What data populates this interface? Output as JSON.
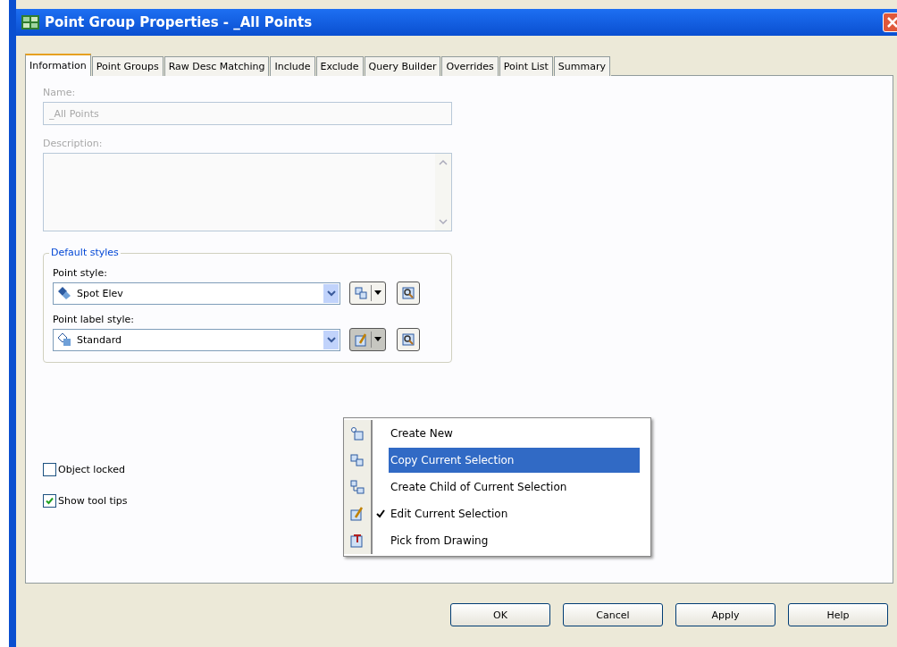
{
  "window": {
    "title": "Point Group Properties - _All Points"
  },
  "tabs": [
    {
      "label": "Information",
      "selected": true
    },
    {
      "label": "Point Groups",
      "selected": false
    },
    {
      "label": "Raw Desc Matching",
      "selected": false
    },
    {
      "label": "Include",
      "selected": false
    },
    {
      "label": "Exclude",
      "selected": false
    },
    {
      "label": "Query Builder",
      "selected": false
    },
    {
      "label": "Overrides",
      "selected": false
    },
    {
      "label": "Point List",
      "selected": false
    },
    {
      "label": "Summary",
      "selected": false
    }
  ],
  "name": {
    "label": "Name:",
    "value": "_All Points",
    "disabled": true
  },
  "description": {
    "label": "Description:",
    "disabled": true
  },
  "default_styles": {
    "title": "Default styles",
    "styles": [
      {
        "label": "Point style:",
        "value": "Spot Elev",
        "kind": "point"
      },
      {
        "label": "Point label style:",
        "value": "Standard",
        "kind": "label"
      }
    ]
  },
  "menu": {
    "items": [
      {
        "label": "Create New",
        "kind": "new",
        "selected": false,
        "checked": false
      },
      {
        "label": "Copy Current Selection",
        "kind": "copy",
        "selected": true,
        "checked": false
      },
      {
        "label": "Create Child of Current Selection",
        "kind": "child",
        "selected": false,
        "checked": false
      },
      {
        "label": "Edit Current Selection",
        "kind": "edit",
        "selected": false,
        "checked": true
      },
      {
        "label": "Pick from Drawing",
        "kind": "pick",
        "selected": false,
        "checked": false
      }
    ]
  },
  "options": [
    {
      "label": "Object locked",
      "checked": false
    },
    {
      "label": "Show tool tips",
      "checked": true
    }
  ],
  "buttons": [
    "OK",
    "Cancel",
    "Apply",
    "Help"
  ]
}
